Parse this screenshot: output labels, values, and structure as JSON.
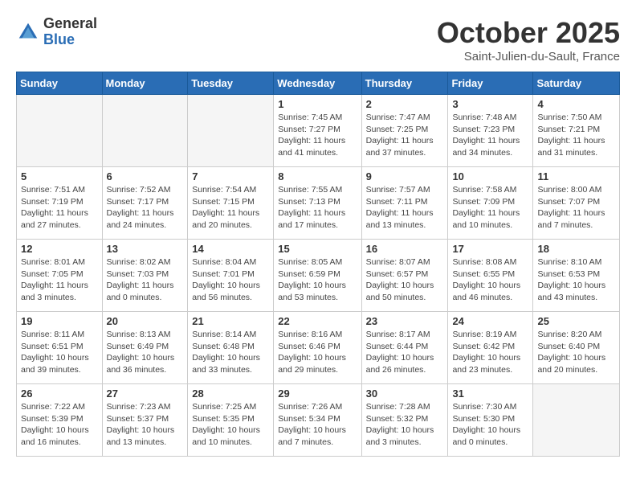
{
  "logo": {
    "general": "General",
    "blue": "Blue"
  },
  "header": {
    "month": "October 2025",
    "location": "Saint-Julien-du-Sault, France"
  },
  "weekdays": [
    "Sunday",
    "Monday",
    "Tuesday",
    "Wednesday",
    "Thursday",
    "Friday",
    "Saturday"
  ],
  "weeks": [
    [
      {
        "day": "",
        "info": ""
      },
      {
        "day": "",
        "info": ""
      },
      {
        "day": "",
        "info": ""
      },
      {
        "day": "1",
        "info": "Sunrise: 7:45 AM\nSunset: 7:27 PM\nDaylight: 11 hours\nand 41 minutes."
      },
      {
        "day": "2",
        "info": "Sunrise: 7:47 AM\nSunset: 7:25 PM\nDaylight: 11 hours\nand 37 minutes."
      },
      {
        "day": "3",
        "info": "Sunrise: 7:48 AM\nSunset: 7:23 PM\nDaylight: 11 hours\nand 34 minutes."
      },
      {
        "day": "4",
        "info": "Sunrise: 7:50 AM\nSunset: 7:21 PM\nDaylight: 11 hours\nand 31 minutes."
      }
    ],
    [
      {
        "day": "5",
        "info": "Sunrise: 7:51 AM\nSunset: 7:19 PM\nDaylight: 11 hours\nand 27 minutes."
      },
      {
        "day": "6",
        "info": "Sunrise: 7:52 AM\nSunset: 7:17 PM\nDaylight: 11 hours\nand 24 minutes."
      },
      {
        "day": "7",
        "info": "Sunrise: 7:54 AM\nSunset: 7:15 PM\nDaylight: 11 hours\nand 20 minutes."
      },
      {
        "day": "8",
        "info": "Sunrise: 7:55 AM\nSunset: 7:13 PM\nDaylight: 11 hours\nand 17 minutes."
      },
      {
        "day": "9",
        "info": "Sunrise: 7:57 AM\nSunset: 7:11 PM\nDaylight: 11 hours\nand 13 minutes."
      },
      {
        "day": "10",
        "info": "Sunrise: 7:58 AM\nSunset: 7:09 PM\nDaylight: 11 hours\nand 10 minutes."
      },
      {
        "day": "11",
        "info": "Sunrise: 8:00 AM\nSunset: 7:07 PM\nDaylight: 11 hours\nand 7 minutes."
      }
    ],
    [
      {
        "day": "12",
        "info": "Sunrise: 8:01 AM\nSunset: 7:05 PM\nDaylight: 11 hours\nand 3 minutes."
      },
      {
        "day": "13",
        "info": "Sunrise: 8:02 AM\nSunset: 7:03 PM\nDaylight: 11 hours\nand 0 minutes."
      },
      {
        "day": "14",
        "info": "Sunrise: 8:04 AM\nSunset: 7:01 PM\nDaylight: 10 hours\nand 56 minutes."
      },
      {
        "day": "15",
        "info": "Sunrise: 8:05 AM\nSunset: 6:59 PM\nDaylight: 10 hours\nand 53 minutes."
      },
      {
        "day": "16",
        "info": "Sunrise: 8:07 AM\nSunset: 6:57 PM\nDaylight: 10 hours\nand 50 minutes."
      },
      {
        "day": "17",
        "info": "Sunrise: 8:08 AM\nSunset: 6:55 PM\nDaylight: 10 hours\nand 46 minutes."
      },
      {
        "day": "18",
        "info": "Sunrise: 8:10 AM\nSunset: 6:53 PM\nDaylight: 10 hours\nand 43 minutes."
      }
    ],
    [
      {
        "day": "19",
        "info": "Sunrise: 8:11 AM\nSunset: 6:51 PM\nDaylight: 10 hours\nand 39 minutes."
      },
      {
        "day": "20",
        "info": "Sunrise: 8:13 AM\nSunset: 6:49 PM\nDaylight: 10 hours\nand 36 minutes."
      },
      {
        "day": "21",
        "info": "Sunrise: 8:14 AM\nSunset: 6:48 PM\nDaylight: 10 hours\nand 33 minutes."
      },
      {
        "day": "22",
        "info": "Sunrise: 8:16 AM\nSunset: 6:46 PM\nDaylight: 10 hours\nand 29 minutes."
      },
      {
        "day": "23",
        "info": "Sunrise: 8:17 AM\nSunset: 6:44 PM\nDaylight: 10 hours\nand 26 minutes."
      },
      {
        "day": "24",
        "info": "Sunrise: 8:19 AM\nSunset: 6:42 PM\nDaylight: 10 hours\nand 23 minutes."
      },
      {
        "day": "25",
        "info": "Sunrise: 8:20 AM\nSunset: 6:40 PM\nDaylight: 10 hours\nand 20 minutes."
      }
    ],
    [
      {
        "day": "26",
        "info": "Sunrise: 7:22 AM\nSunset: 5:39 PM\nDaylight: 10 hours\nand 16 minutes."
      },
      {
        "day": "27",
        "info": "Sunrise: 7:23 AM\nSunset: 5:37 PM\nDaylight: 10 hours\nand 13 minutes."
      },
      {
        "day": "28",
        "info": "Sunrise: 7:25 AM\nSunset: 5:35 PM\nDaylight: 10 hours\nand 10 minutes."
      },
      {
        "day": "29",
        "info": "Sunrise: 7:26 AM\nSunset: 5:34 PM\nDaylight: 10 hours\nand 7 minutes."
      },
      {
        "day": "30",
        "info": "Sunrise: 7:28 AM\nSunset: 5:32 PM\nDaylight: 10 hours\nand 3 minutes."
      },
      {
        "day": "31",
        "info": "Sunrise: 7:30 AM\nSunset: 5:30 PM\nDaylight: 10 hours\nand 0 minutes."
      },
      {
        "day": "",
        "info": ""
      }
    ]
  ]
}
